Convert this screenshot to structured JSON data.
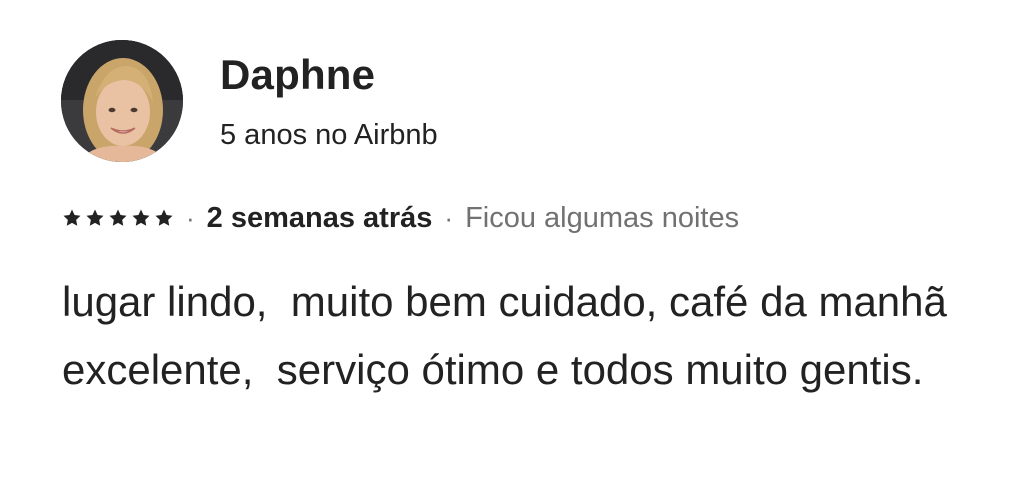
{
  "review": {
    "reviewer": {
      "name": "Daphne",
      "tenure": "5 anos no Airbnb",
      "avatar_icon": "user-photo"
    },
    "rating": {
      "stars": 5,
      "max_stars": 5,
      "star_icon": "star-icon",
      "separator": "·"
    },
    "date": "2 semanas atrás",
    "stay_length": "Ficou algumas noites",
    "text": "lugar lindo,  muito bem cuidado, café da manhã excelente,  serviço ótimo e todos muito gentis."
  },
  "colors": {
    "primary_text": "#222222",
    "secondary_text": "#717171",
    "background": "#ffffff"
  }
}
